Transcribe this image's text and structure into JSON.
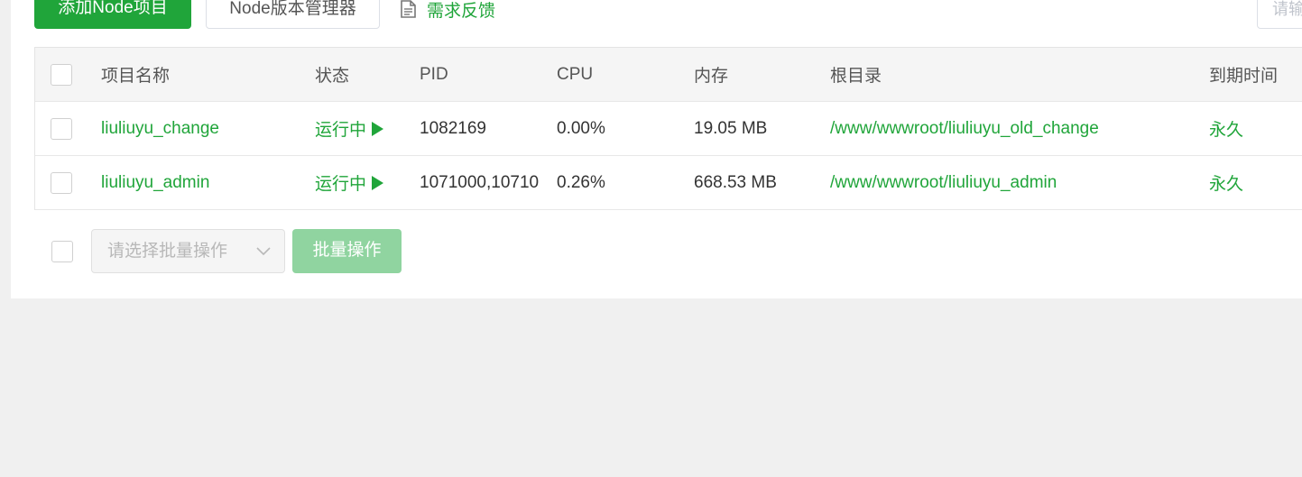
{
  "toolbar": {
    "add_button": "添加Node项目",
    "version_manager_button": "Node版本管理器",
    "feedback_link": "需求反馈",
    "search_placeholder": "请输"
  },
  "table": {
    "columns": [
      "项目名称",
      "状态",
      "PID",
      "CPU",
      "内存",
      "根目录",
      "到期时间"
    ],
    "rows": [
      {
        "name": "liuliuyu_change",
        "status": "运行中",
        "pid": "1082169",
        "cpu": "0.00%",
        "memory": "19.05 MB",
        "root": "/www/wwwroot/liuliuyu_old_change",
        "expire": "永久"
      },
      {
        "name": "liuliuyu_admin",
        "status": "运行中",
        "pid": "1071000,10710",
        "cpu": "0.26%",
        "memory": "668.53 MB",
        "root": "/www/wwwroot/liuliuyu_admin",
        "expire": "永久"
      }
    ]
  },
  "batch": {
    "select_placeholder": "请选择批量操作",
    "button": "批量操作"
  },
  "colors": {
    "accent": "#20a53a",
    "accent_disabled": "#90d4a0",
    "header_bg": "#f5f5f5",
    "page_bg": "#f0f0f0"
  },
  "icons": {
    "feedback": "edit-document-icon",
    "status_running": "play-icon",
    "select_arrow": "chevron-down-icon"
  }
}
